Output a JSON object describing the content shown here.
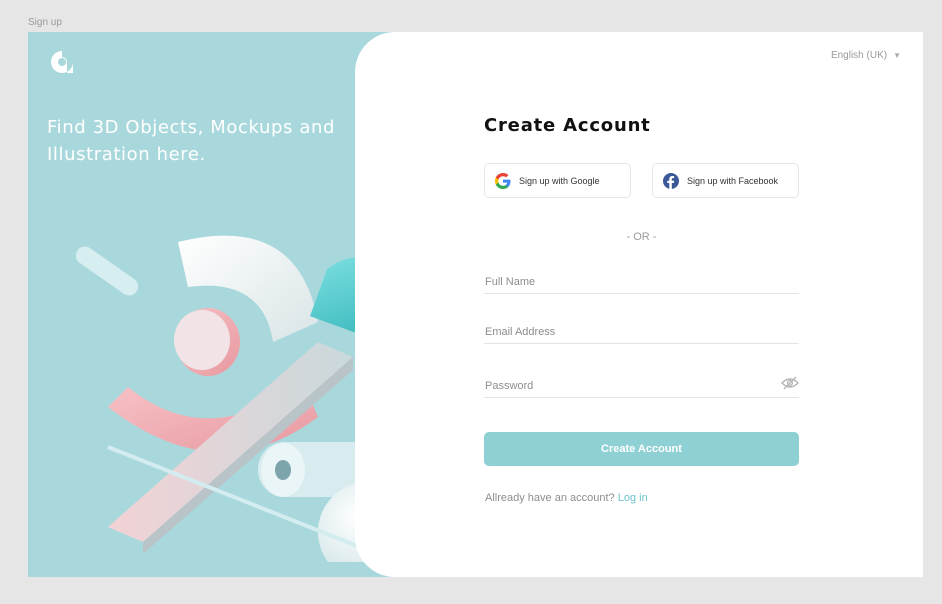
{
  "frame_label": "Sign up",
  "left": {
    "tagline": "Find 3D Objects, Mockups and Illustration here."
  },
  "header": {
    "language": "English (UK)"
  },
  "form": {
    "title": "Create Account",
    "google_label": "Sign up with Google",
    "facebook_label": "Sign up with Facebook",
    "divider": "- OR -",
    "full_name_placeholder": "Full Name",
    "email_placeholder": "Email Address",
    "password_placeholder": "Password",
    "submit_label": "Create Account",
    "login_prompt": "Allready have an account?",
    "login_link": "Log in"
  },
  "colors": {
    "left_background": "#a9d8dc",
    "accent": "#8fd0d5",
    "link": "#6cc4cb"
  },
  "icons": [
    "logo-icon",
    "google-icon",
    "facebook-icon",
    "eye-off-icon",
    "caret-down-icon"
  ]
}
